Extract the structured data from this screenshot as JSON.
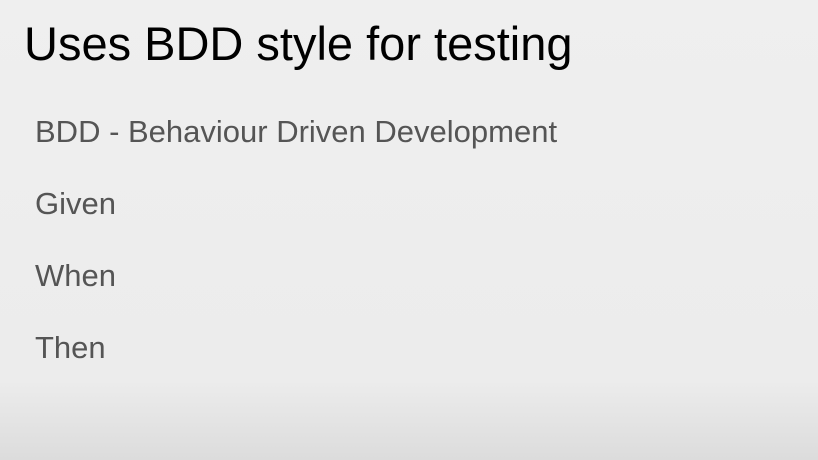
{
  "slide": {
    "title": "Uses BDD style for testing",
    "bullets": [
      "BDD - Behaviour Driven Development",
      "Given",
      "When",
      "Then"
    ]
  },
  "colors": {
    "background": "#eeeeee",
    "title_text": "#000000",
    "body_text": "#555555"
  }
}
